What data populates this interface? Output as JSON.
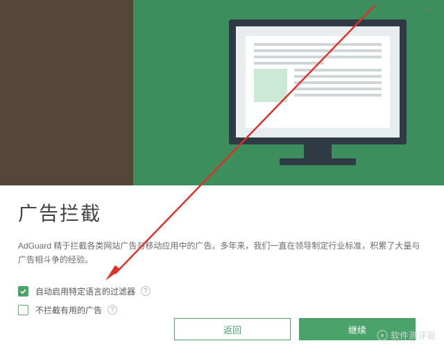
{
  "window": {
    "minimize": "–",
    "close": "×"
  },
  "content": {
    "title": "广告拦截",
    "description": "AdGuard 精于拦截各类网站广告与移动应用中的广告。多年来，我们一直在领导制定行业标准，积累了大量与广告相斗争的经验。"
  },
  "options": {
    "opt1": {
      "label": "自动启用特定语言的过滤器",
      "checked": true
    },
    "opt2": {
      "label": "不拦截有用的广告",
      "checked": false
    }
  },
  "buttons": {
    "back": "返回",
    "next": "继续"
  },
  "watermark": {
    "text": "软件测评说"
  },
  "colors": {
    "accent": "#4aa36b",
    "arrow": "#e13028"
  }
}
